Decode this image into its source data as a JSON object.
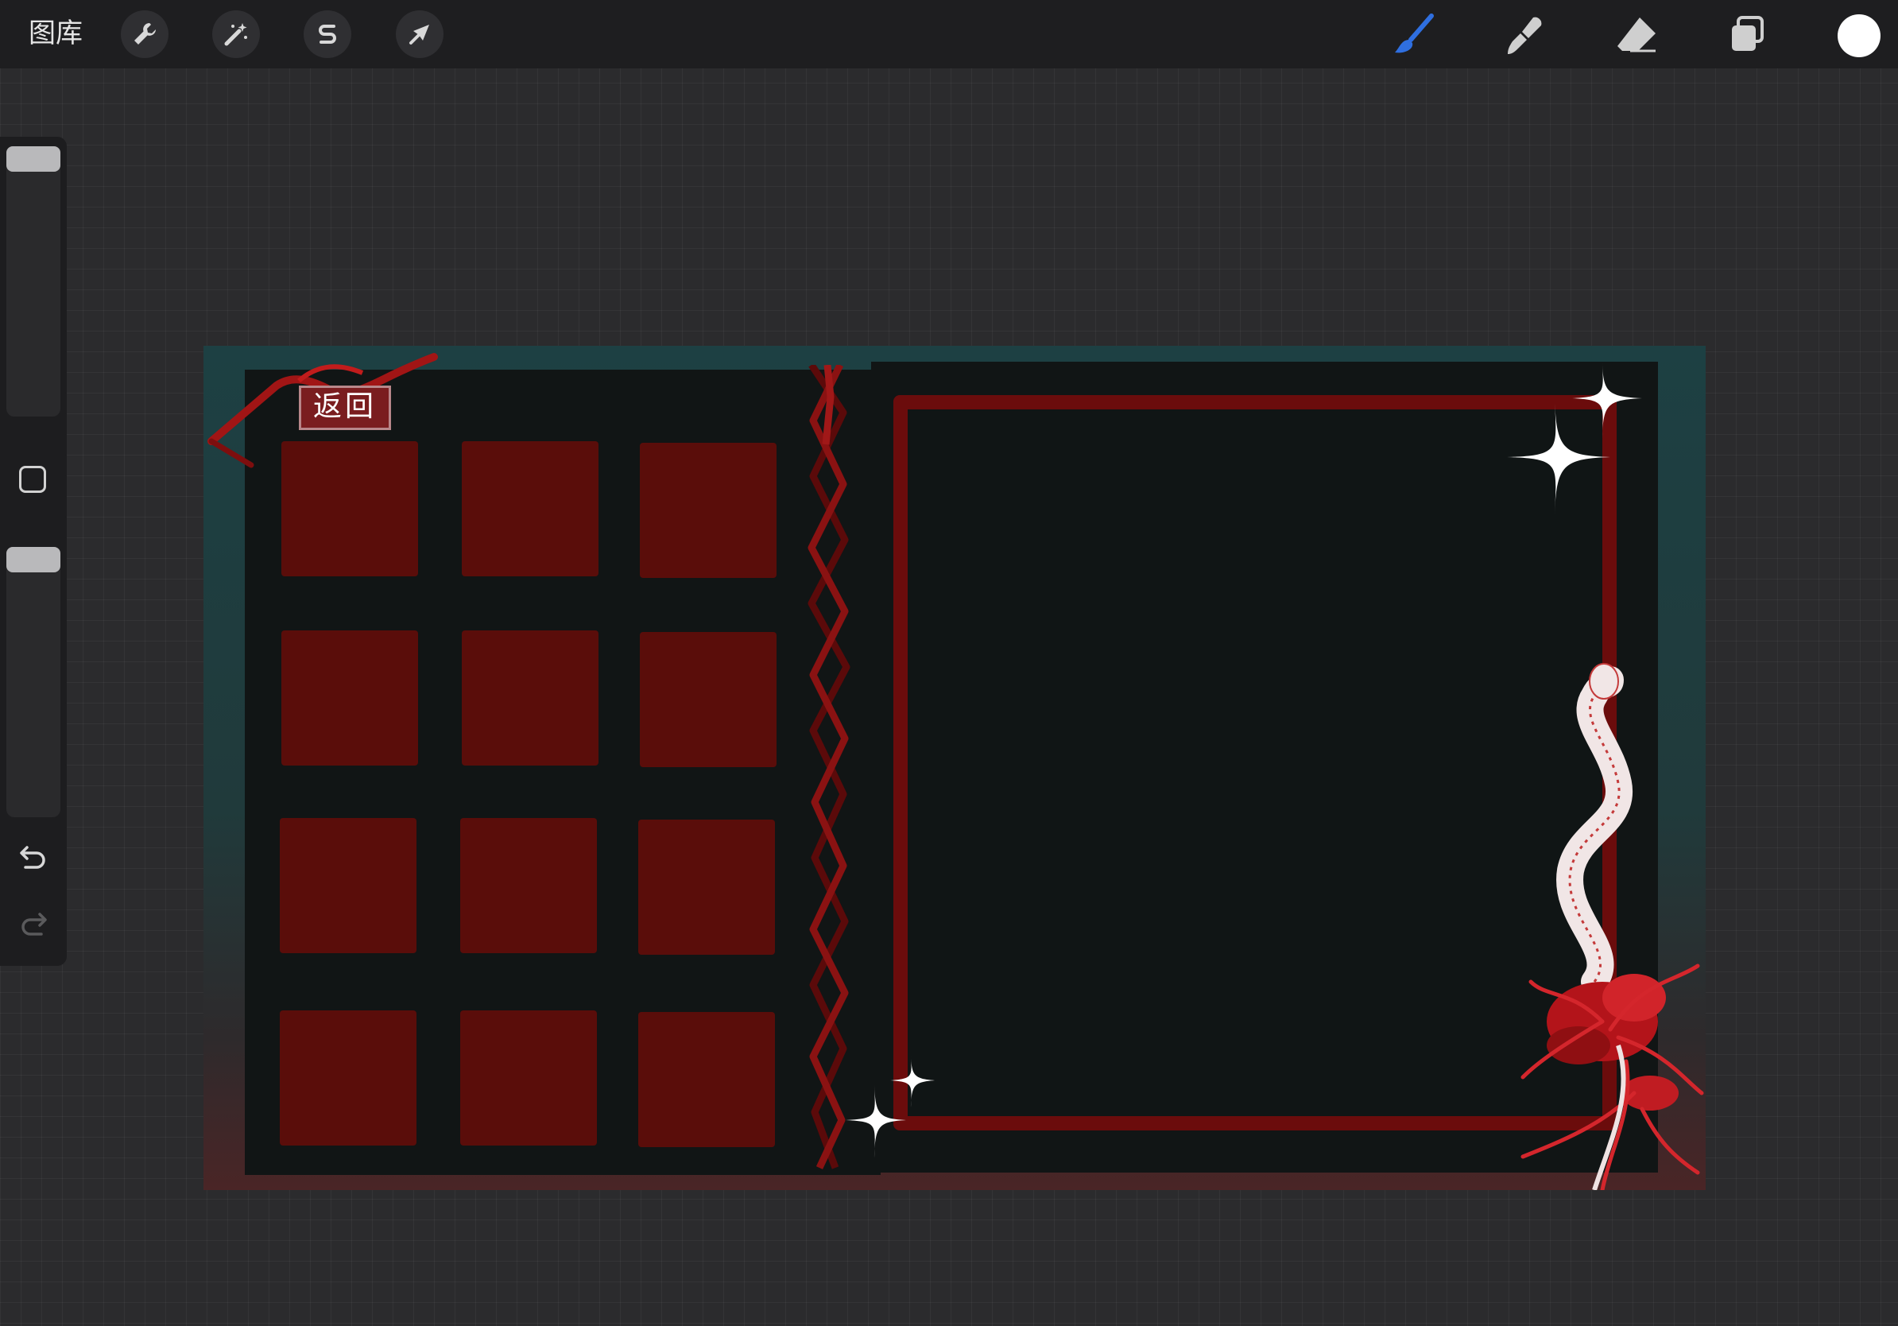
{
  "topbar": {
    "gallery_label": "图库",
    "left_tools": [
      {
        "name": "actions",
        "icon": "wrench-icon"
      },
      {
        "name": "adjustments",
        "icon": "magic-wand-icon"
      },
      {
        "name": "selection",
        "icon": "selection-s-icon"
      },
      {
        "name": "transform",
        "icon": "arrow-cursor-icon"
      }
    ],
    "right_tools": [
      {
        "name": "brush",
        "icon": "brush-icon",
        "active": true
      },
      {
        "name": "smudge",
        "icon": "smudge-icon"
      },
      {
        "name": "eraser",
        "icon": "eraser-icon"
      },
      {
        "name": "layers",
        "icon": "layers-icon"
      },
      {
        "name": "color",
        "icon": "color-swatch",
        "value": "#ffffff"
      }
    ]
  },
  "sidebar": {
    "brush_size_level": 0.95,
    "opacity_level": 0.95
  },
  "canvas": {
    "back_button_text": "返回",
    "tile_grid": {
      "rows": 4,
      "cols": 3
    },
    "colors": {
      "tile": "#5a0d0a",
      "frame": "#6b0c0c",
      "panel": "#111515",
      "active_tool": "#2f6fe0"
    }
  }
}
